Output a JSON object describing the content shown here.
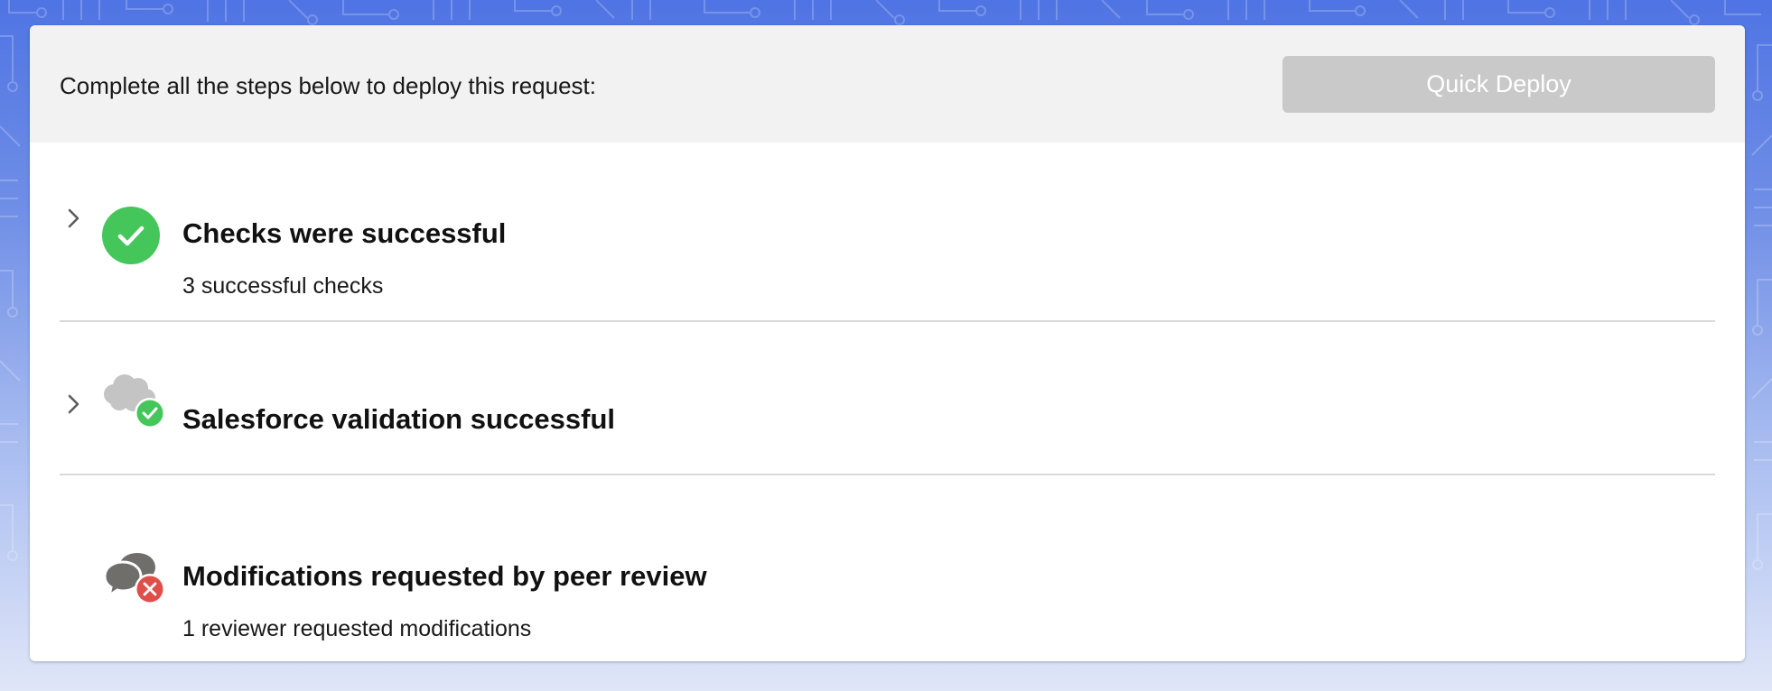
{
  "header": {
    "instruction": "Complete all the steps below to deploy this request:",
    "quick_deploy_label": "Quick Deploy"
  },
  "steps": [
    {
      "title": "Checks were successful",
      "subtitle": "3 successful checks",
      "status": "success",
      "icon": "check-circle-icon",
      "expandable": true
    },
    {
      "title": "Salesforce validation successful",
      "subtitle": "",
      "status": "success",
      "icon": "salesforce-cloud-check-icon",
      "expandable": true
    },
    {
      "title": "Modifications requested by peer review",
      "subtitle": "1 reviewer requested modifications",
      "status": "error",
      "icon": "chat-bubbles-error-icon",
      "expandable": false
    }
  ],
  "colors": {
    "success": "#45c65a",
    "error": "#e04e4a",
    "button_disabled": "#c9c9c9",
    "header_bg": "#f2f2f2",
    "icon_gray": "#c4c4c4",
    "icon_dark_gray": "#706e6b"
  }
}
